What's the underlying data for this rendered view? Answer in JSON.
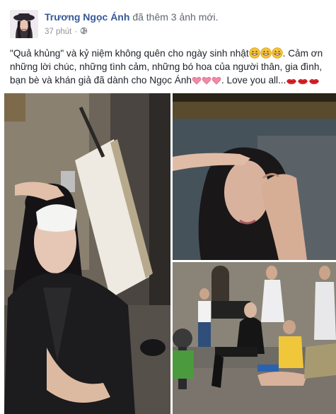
{
  "post": {
    "author_name": "Trương Ngọc Ánh",
    "action_text": "đã thêm 3 ảnh mới.",
    "timestamp": "37 phút",
    "separator": "·",
    "privacy_icon": "globe-icon",
    "text_lines": [
      "\"Quả khủng\" và kỷ niệm không quên cho ngày sinh nhật",
      ". Cảm ơn",
      "những lời chúc, những tình cảm, những bó hoa của người thân, gia đình,",
      "bạn bè và khán giả đã dành cho Ngọc Ánh",
      ". Love you all..."
    ],
    "emojis": {
      "grin": "grinning-face-emoji",
      "heart": "pink-heart-emoji",
      "kiss": "kiss-lips-emoji"
    }
  },
  "photos": [
    {
      "name": "photo-woman-eye-patch-studio",
      "alt": "Woman with eye patch sitting in studio"
    },
    {
      "name": "photo-woman-makeup-closeup",
      "alt": "Woman receiving makeup close-up"
    },
    {
      "name": "photo-behind-scenes-crew",
      "alt": "Crew behind the scenes"
    }
  ],
  "colors": {
    "link_blue": "#365899",
    "meta_gray": "#90949c",
    "text": "#1d2129"
  }
}
